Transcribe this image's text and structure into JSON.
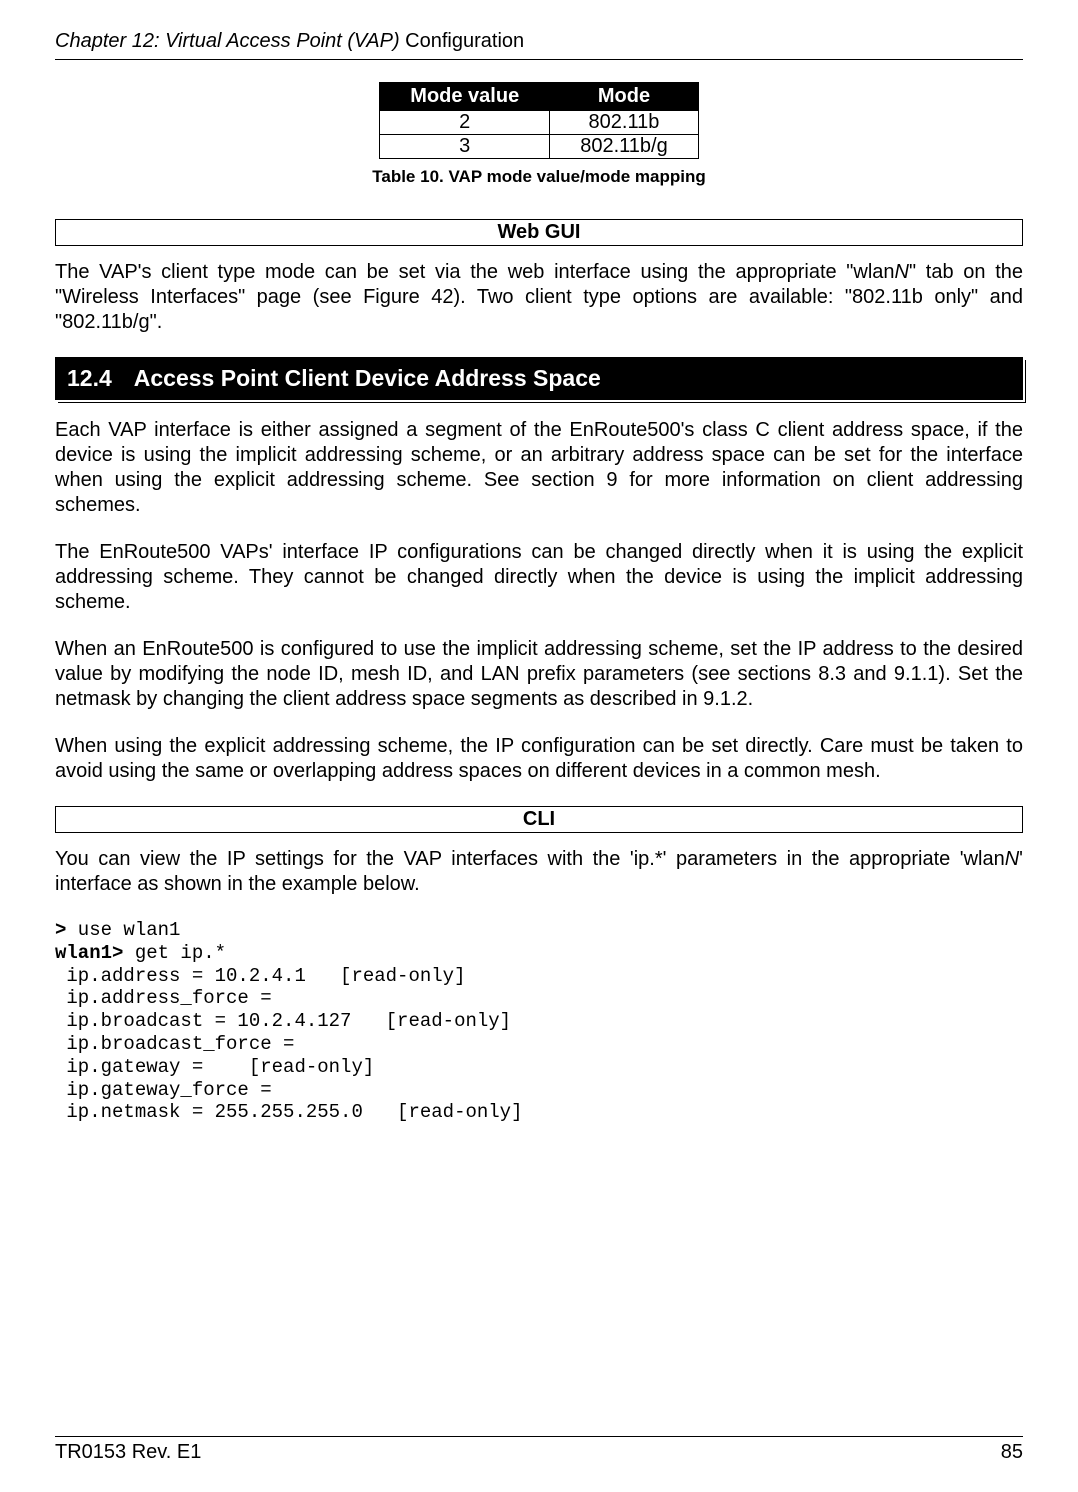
{
  "header": {
    "chapter_prefix": "Chapter 12: Virtual Access Point (VAP) ",
    "chapter_suffix": "Configuration"
  },
  "mode_table": {
    "header_left": "Mode value",
    "header_right": "Mode",
    "rows": [
      {
        "value": "2",
        "mode": "802.11b"
      },
      {
        "value": "3",
        "mode": "802.11b/g"
      }
    ]
  },
  "table_caption": "Table 10. VAP mode value/mode mapping",
  "webgui_heading": "Web GUI",
  "webgui_para": "The VAP's client type mode can be set via the web interface using the appropriate \"wlanN\" tab on the \"Wireless Interfaces\" page (see Figure 42). Two client type options are available: \"802.11b only\" and \"802.11b/g\".",
  "section": {
    "number": "12.4",
    "title": "Access Point Client Device Address Space"
  },
  "para1": "Each VAP interface is either assigned a segment of the EnRoute500's class C client address space, if the device is using the implicit addressing scheme, or an arbitrary address space can be set for the interface when using the explicit addressing scheme. See section 9 for more information on client addressing schemes.",
  "para2": "The EnRoute500 VAPs' interface IP configurations can be changed directly when it is using the explicit addressing scheme. They cannot be changed directly when the device is using the implicit addressing scheme.",
  "para3": "When an EnRoute500 is configured to use the implicit addressing scheme, set the IP address to the desired value by modifying the node ID, mesh ID, and LAN prefix parameters (see sections 8.3 and 9.1.1). Set the netmask by changing the client address space segments as described in 9.1.2.",
  "para4": "When using the explicit addressing scheme, the IP configuration can be set directly. Care must be taken to avoid using the same or overlapping address spaces on different devices in a common mesh.",
  "cli_heading": "CLI",
  "cli_intro": "You can view the IP settings for the VAP interfaces with the 'ip.*' parameters in the appropriate 'wlanN' interface as shown in the example below.",
  "cli": {
    "prompt1": ">",
    "cmd1": " use wlan1",
    "prompt2": "wlan1>",
    "cmd2": " get ip.*",
    "line1": " ip.address = 10.2.4.1   [read-only]",
    "line2": " ip.address_force =",
    "line3": " ip.broadcast = 10.2.4.127   [read-only]",
    "line4": " ip.broadcast_force =",
    "line5": " ip.gateway =    [read-only]",
    "line6": " ip.gateway_force =",
    "line7": " ip.netmask = 255.255.255.0   [read-only]"
  },
  "footer": {
    "left": "TR0153 Rev. E1",
    "right": "85"
  }
}
